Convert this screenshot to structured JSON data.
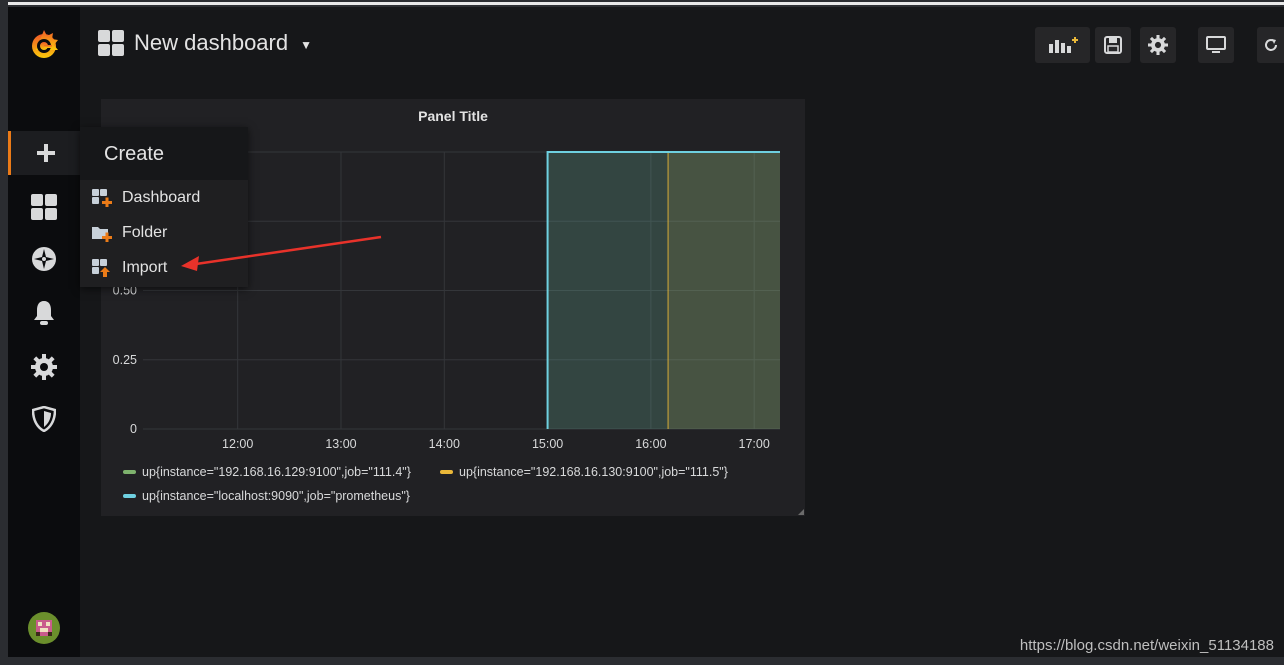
{
  "header": {
    "title": "New dashboard"
  },
  "create_menu": {
    "title": "Create",
    "items": [
      {
        "label": "Dashboard",
        "icon": "dashboard-plus-icon"
      },
      {
        "label": "Folder",
        "icon": "folder-plus-icon"
      },
      {
        "label": "Import",
        "icon": "import-icon"
      }
    ]
  },
  "sidebar": [
    "grafana-logo-icon",
    "plus-icon",
    "dashboards-icon",
    "explore-icon",
    "alert-bell-icon",
    "gear-icon",
    "shield-icon",
    "avatar"
  ],
  "toolbar": [
    "add-panel-icon",
    "save-icon",
    "settings-icon",
    "tv-mode-icon",
    "refresh-icon"
  ],
  "panel": {
    "title": "Panel Title"
  },
  "chart_data": {
    "type": "area",
    "title": "Panel Title",
    "x_ticks": [
      "12:00",
      "13:00",
      "14:00",
      "15:00",
      "16:00",
      "17:00"
    ],
    "y_ticks": [
      "0",
      "0.25",
      "0.50"
    ],
    "ylim": [
      0,
      1
    ],
    "xlim": [
      "11:05",
      "17:15"
    ],
    "grid": true,
    "legend_position": "bottom",
    "series": [
      {
        "name": "up{instance=\"192.168.16.129:9100\",job=\"111.4\"}",
        "color": "#7eb26d",
        "x": [
          "15:00",
          "17:15"
        ],
        "y": [
          1,
          1
        ]
      },
      {
        "name": "up{instance=\"192.168.16.130:9100\",job=\"111.5\"}",
        "color": "#eab839",
        "x": [
          "16:10",
          "17:15"
        ],
        "y": [
          1,
          1
        ]
      },
      {
        "name": "up{instance=\"localhost:9090\",job=\"prometheus\"}",
        "color": "#6ed0e0",
        "x": [
          "15:00",
          "17:15"
        ],
        "y": [
          1,
          1
        ]
      }
    ]
  },
  "watermark": "https://blog.csdn.net/weixin_51134188",
  "colors": {
    "accent": "#eb7b18",
    "background": "#161719",
    "panel": "#212124",
    "annotation_arrow": "#e8322a"
  }
}
